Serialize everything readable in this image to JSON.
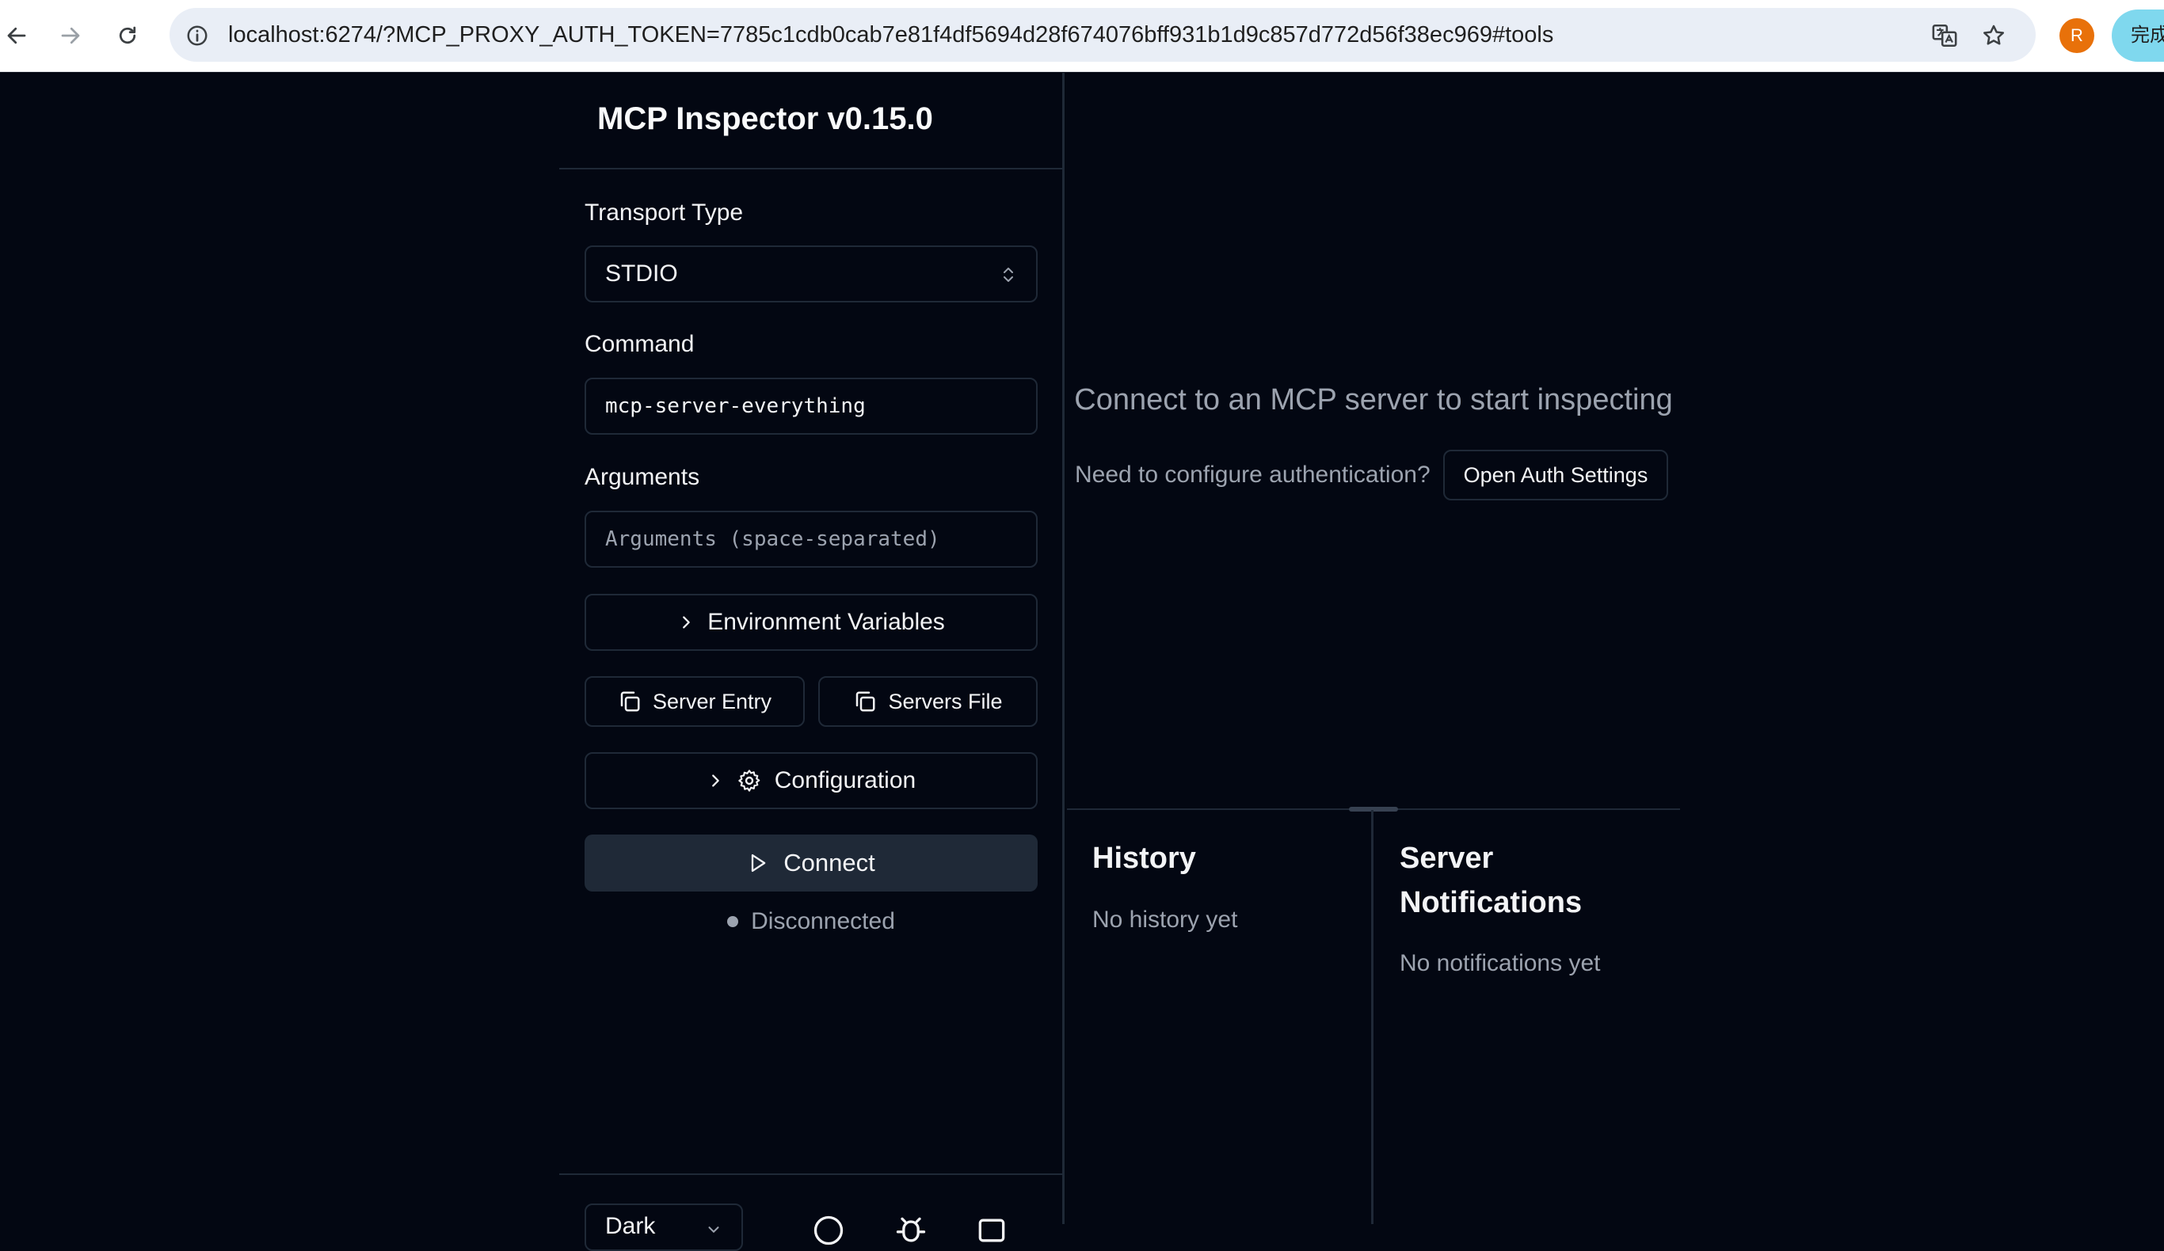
{
  "browser": {
    "url": "localhost:6274/?MCP_PROXY_AUTH_TOKEN=7785c1cdb0cab7e81f4df5694d28f674076bff931b1d9c857d772d56f38ec969#tools",
    "profile_initial": "R",
    "extension_label": "完成"
  },
  "sidebar": {
    "title": "MCP Inspector v0.15.0",
    "transport_label": "Transport Type",
    "transport_value": "STDIO",
    "command_label": "Command",
    "command_value": "mcp-server-everything",
    "arguments_label": "Arguments",
    "arguments_placeholder": "Arguments (space-separated)",
    "env_button": "Environment Variables",
    "server_entry_button": "Server Entry",
    "servers_file_button": "Servers File",
    "config_button": "Configuration",
    "connect_button": "Connect",
    "status": "Disconnected",
    "theme_value": "Dark"
  },
  "main": {
    "empty_title": "Connect to an MCP server to start inspecting",
    "auth_prompt": "Need to configure authentication?",
    "auth_button": "Open Auth Settings"
  },
  "history": {
    "title": "History",
    "empty": "No history yet"
  },
  "notifications": {
    "title": "Server Notifications",
    "empty": "No notifications yet"
  },
  "colors": {
    "background": "#030712",
    "border": "#1f2937",
    "connect_button_bg": "#1f2937",
    "muted_text": "#9ca3af",
    "avatar": "#e8710a"
  }
}
